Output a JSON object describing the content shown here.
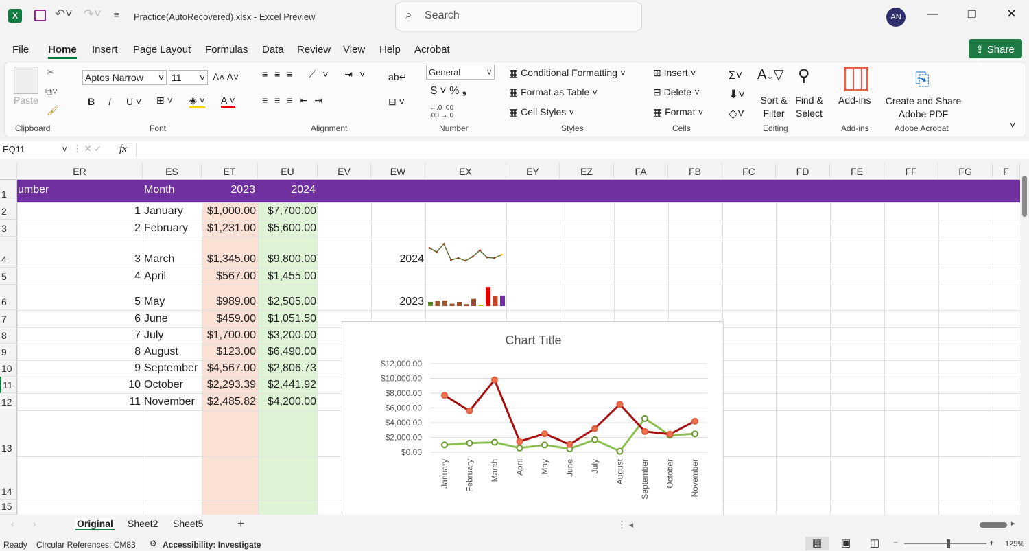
{
  "window": {
    "filename": "Practice(AutoRecovered).xlsx",
    "separator": "-",
    "app": "Excel Preview",
    "search_placeholder": "Search",
    "avatar": "AN"
  },
  "menu": [
    "File",
    "Home",
    "Insert",
    "Page Layout",
    "Formulas",
    "Data",
    "Review",
    "View",
    "Help",
    "Acrobat"
  ],
  "share_label": "Share",
  "ribbon": {
    "paste": "Paste",
    "clipboard": "Clipboard",
    "font_name": "Aptos Narrow",
    "font_size": "11",
    "font": "Font",
    "alignment": "Alignment",
    "number_format": "General",
    "number": "Number",
    "cond_format": "Conditional Formatting",
    "format_table": "Format as Table",
    "cell_styles": "Cell Styles",
    "styles": "Styles",
    "insert": "Insert",
    "delete": "Delete",
    "format": "Format",
    "cells": "Cells",
    "sort_filter": "Sort & Filter",
    "find_select": "Find & Select",
    "editing": "Editing",
    "addins": "Add-ins",
    "addins_group": "Add-ins",
    "create_pdf": "Create and Share Adobe PDF",
    "acrobat_group": "Adobe Acrobat"
  },
  "formula_bar": {
    "name_box": "EQ11",
    "fx": "fx",
    "value": ""
  },
  "columns": [
    "ER",
    "ES",
    "ET",
    "EU",
    "EV",
    "EW",
    "EX",
    "EY",
    "EZ",
    "FA",
    "FB",
    "FC",
    "FD",
    "FE",
    "FF",
    "FG",
    "F"
  ],
  "header_row": {
    "number": "umber",
    "month": "Month",
    "y2023": "2023",
    "y2024": "2024"
  },
  "rows": [
    {
      "n": "1",
      "month": "January",
      "v2023": "$1,000.00",
      "v2024": "$7,700.00"
    },
    {
      "n": "2",
      "month": "February",
      "v2023": "$1,231.00",
      "v2024": "$5,600.00"
    },
    {
      "n": "3",
      "month": "March",
      "v2023": "$1,345.00",
      "v2024": "$9,800.00"
    },
    {
      "n": "4",
      "month": "April",
      "v2023": "$567.00",
      "v2024": "$1,455.00"
    },
    {
      "n": "5",
      "month": "May",
      "v2023": "$989.00",
      "v2024": "$2,505.00"
    },
    {
      "n": "6",
      "month": "June",
      "v2023": "$459.00",
      "v2024": "$1,051.50"
    },
    {
      "n": "7",
      "month": "July",
      "v2023": "$1,700.00",
      "v2024": "$3,200.00"
    },
    {
      "n": "8",
      "month": "August",
      "v2023": "$123.00",
      "v2024": "$6,490.00"
    },
    {
      "n": "9",
      "month": "September",
      "v2023": "$4,567.00",
      "v2024": "$2,806.73"
    },
    {
      "n": "10",
      "month": "October",
      "v2023": "$2,293.39",
      "v2024": "$2,441.92"
    },
    {
      "n": "11",
      "month": "November",
      "v2023": "$2,485.82",
      "v2024": "$4,200.00"
    }
  ],
  "sparklines": {
    "line_label": "2024",
    "bar_label": "2023"
  },
  "chart_data": {
    "type": "line",
    "title": "Chart Title",
    "categories": [
      "January",
      "February",
      "March",
      "April",
      "May",
      "June",
      "July",
      "August",
      "September",
      "October",
      "November"
    ],
    "series": [
      {
        "values": [
          1000,
          1231,
          1345,
          567,
          989,
          459,
          1700,
          123,
          4567,
          2293.39,
          2485.82
        ],
        "color": "#8cc152"
      },
      {
        "values": [
          7700,
          5600,
          9800,
          1455,
          2505,
          1051.5,
          3200,
          6490,
          2806.73,
          2441.92,
          4200
        ],
        "color": "#a50f0f"
      }
    ],
    "yticks": [
      "$0.00",
      "$2,000.00",
      "$4,000.00",
      "$6,000.00",
      "$8,000.00",
      "$10,000.00",
      "$12,000.00"
    ],
    "ylim": [
      0,
      12000
    ],
    "grid": true
  },
  "sheets": [
    "Original",
    "Sheet2",
    "Sheet5"
  ],
  "active_sheet": "Original",
  "status": {
    "ready": "Ready",
    "circular": "Circular References: CM83",
    "accessibility": "Accessibility: Investigate",
    "zoom": "125%"
  },
  "colors": {
    "header_purple": "#7030a0",
    "col_2023": "#fbe0d6",
    "col_2024": "#dff3d6",
    "share_green": "#1e7b45"
  }
}
